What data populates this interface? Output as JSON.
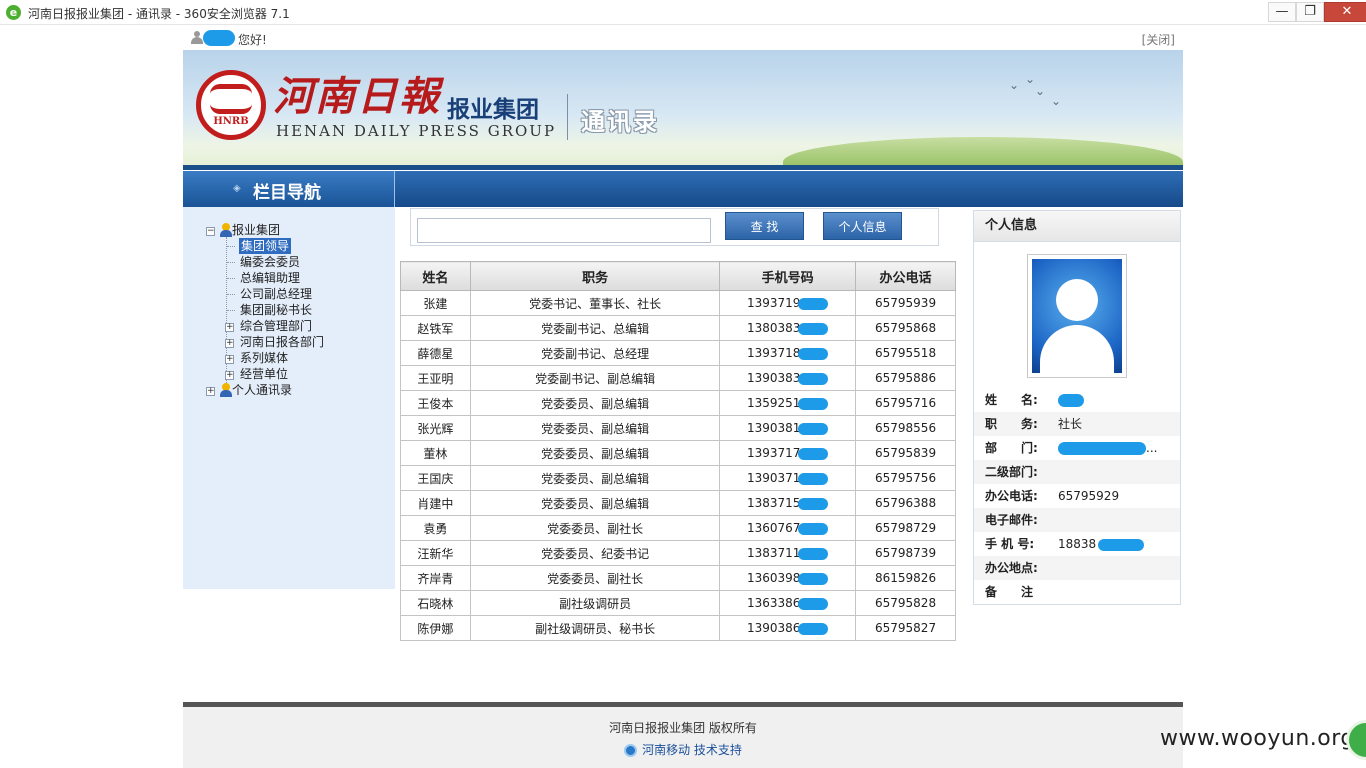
{
  "browser": {
    "title": "河南日报报业集团 - 通讯录 - 360安全浏览器 7.1",
    "minimize": "—",
    "maximize": "❐",
    "close": "✕"
  },
  "greeting": {
    "hello": "您好!",
    "close_link": "[关闭]"
  },
  "banner": {
    "logo_abbr": "HNRB",
    "paper_name": "河南日報",
    "group_name": "报业集团",
    "english": "HENAN DAILY PRESS GROUP",
    "section": "通讯录"
  },
  "nav": {
    "title": "栏目导航"
  },
  "tree": {
    "root1": "报业集团",
    "leaves": [
      "集团领导",
      "编委会委员",
      "总编辑助理",
      "公司副总经理",
      "集团副秘书长"
    ],
    "branches": [
      "综合管理部门",
      "河南日报各部门",
      "系列媒体",
      "经营单位"
    ],
    "root2": "个人通讯录"
  },
  "search": {
    "value": "",
    "find_button": "查 找",
    "info_button": "个人信息"
  },
  "table": {
    "headers": [
      "姓名",
      "职务",
      "手机号码",
      "办公电话"
    ],
    "rows": [
      {
        "name": "张建",
        "title": "党委书记、董事长、社长",
        "mobile": "1393719",
        "office": "65795939"
      },
      {
        "name": "赵铁军",
        "title": "党委副书记、总编辑",
        "mobile": "1380383",
        "office": "65795868"
      },
      {
        "name": "薛德星",
        "title": "党委副书记、总经理",
        "mobile": "1393718",
        "office": "65795518"
      },
      {
        "name": "王亚明",
        "title": "党委副书记、副总编辑",
        "mobile": "1390383",
        "office": "65795886"
      },
      {
        "name": "王俊本",
        "title": "党委委员、副总编辑",
        "mobile": "1359251",
        "office": "65795716"
      },
      {
        "name": "张光辉",
        "title": "党委委员、副总编辑",
        "mobile": "1390381",
        "office": "65798556"
      },
      {
        "name": "董林",
        "title": "党委委员、副总编辑",
        "mobile": "1393717",
        "office": "65795839"
      },
      {
        "name": "王国庆",
        "title": "党委委员、副总编辑",
        "mobile": "1390371",
        "office": "65795756"
      },
      {
        "name": "肖建中",
        "title": "党委委员、副总编辑",
        "mobile": "1383715",
        "office": "65796388"
      },
      {
        "name": "袁勇",
        "title": "党委委员、副社长",
        "mobile": "1360767",
        "office": "65798729"
      },
      {
        "name": "汪新华",
        "title": "党委委员、纪委书记",
        "mobile": "1383711",
        "office": "65798739"
      },
      {
        "name": "齐岸青",
        "title": "党委委员、副社长",
        "mobile": "1360398",
        "office": "86159826"
      },
      {
        "name": "石晓林",
        "title": "副社级调研员",
        "mobile": "1363386",
        "office": "65795828"
      },
      {
        "name": "陈伊娜",
        "title": "副社级调研员、秘书长",
        "mobile": "1390386",
        "office": "65795827"
      }
    ]
  },
  "info": {
    "header": "个人信息",
    "labels": {
      "name": "姓　　名:",
      "duty": "职　　务:",
      "dept": "部　　门:",
      "dept2": "二级部门:",
      "office_phone": "办公电话:",
      "email": "电子邮件:",
      "mobile": "手 机 号:",
      "location": "办公地点:",
      "remark": "备　　注"
    },
    "values": {
      "name": "",
      "duty": "社长",
      "dept": "...",
      "dept2": "",
      "office_phone": "65795929",
      "email": "",
      "mobile": "18838",
      "location": "",
      "remark": ""
    }
  },
  "footer": {
    "copyright": "河南日报报业集团 版权所有",
    "support": "河南移动 技术支持"
  },
  "watermark": "www.wooyun.org",
  "colors": {
    "nav_blue": "#1a4f8a",
    "sidebar_bg": "#e4eefa",
    "redaction": "#1e9be8",
    "logo_red": "#c21d1d"
  }
}
